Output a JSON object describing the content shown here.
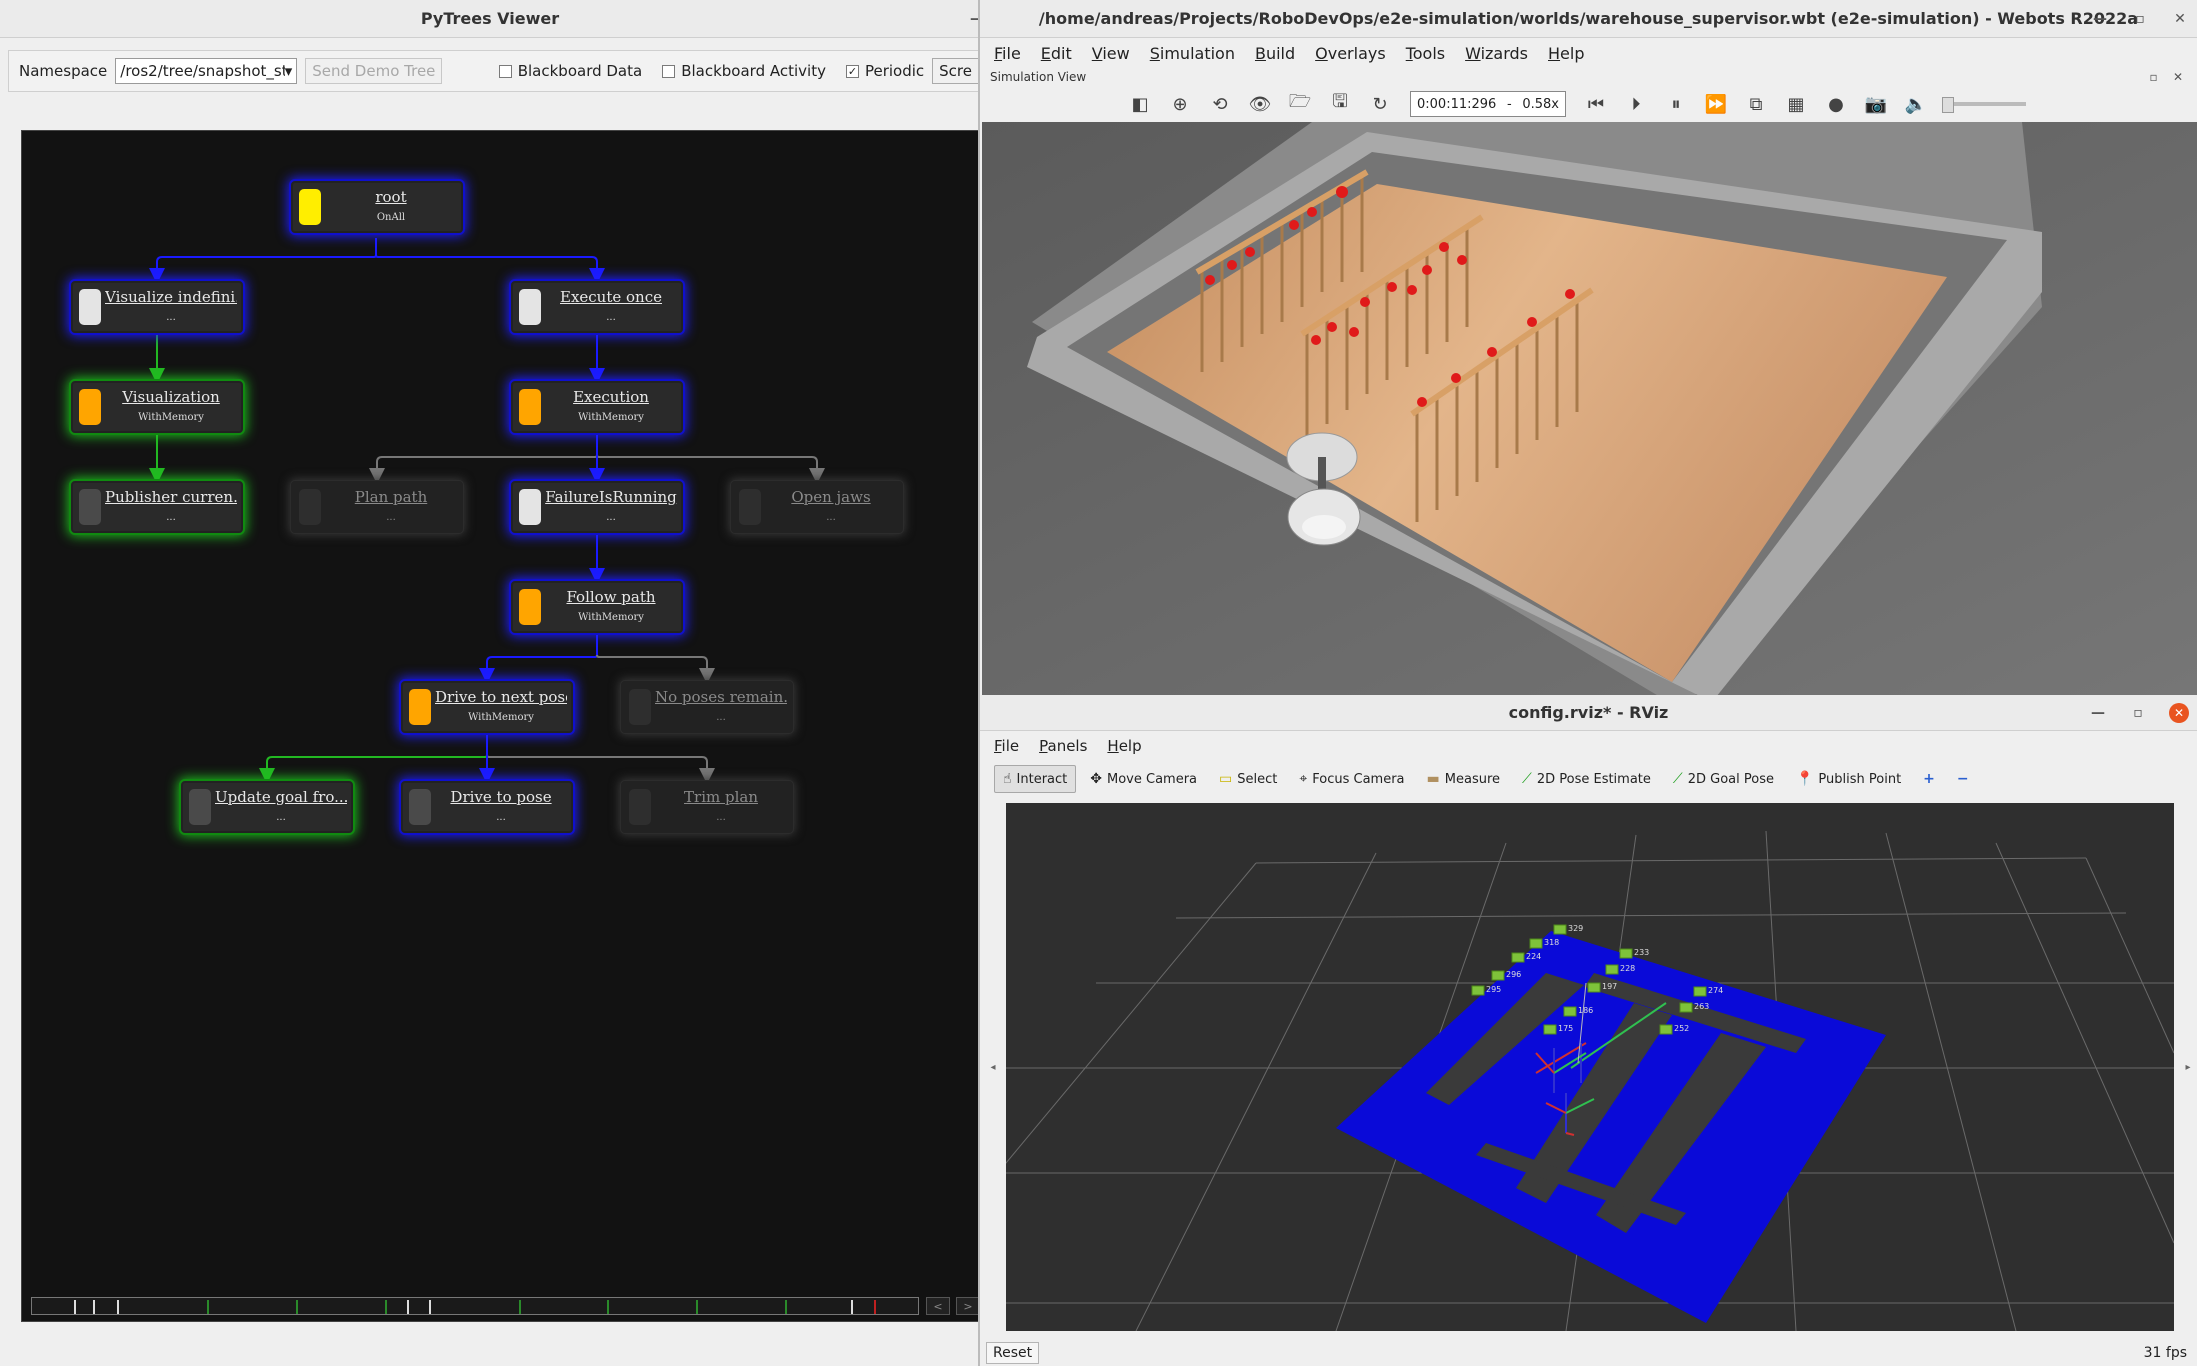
{
  "pytrees": {
    "title": "PyTrees Viewer",
    "namespace_label": "Namespace",
    "namespace_value": "/ros2/tree/snapshot_st",
    "send_demo_label": "Send Demo Tree",
    "blackboard_data_label": "Blackboard Data",
    "blackboard_activity_label": "Blackboard Activity",
    "periodic_label": "Periodic",
    "screenshot_label": "Scre",
    "nodes": {
      "root": {
        "name": "root",
        "sub": "OnAll",
        "status_color": "#ffee00"
      },
      "visualize": {
        "name": "Visualize indefini...",
        "sub": "...",
        "status_color": "#e4e4e4"
      },
      "execute_once": {
        "name": "Execute once",
        "sub": "...",
        "status_color": "#e4e4e4"
      },
      "visualization": {
        "name": "Visualization",
        "sub": "WithMemory",
        "status_color": "#ffa500"
      },
      "execution": {
        "name": "Execution",
        "sub": "WithMemory",
        "status_color": "#ffa500"
      },
      "publisher": {
        "name": "Publisher curren...",
        "sub": "...",
        "status_color": "#4a4a4a"
      },
      "plan_path": {
        "name": "Plan path",
        "sub": "...",
        "status_color": "#2e2e2e"
      },
      "failure_running": {
        "name": "FailureIsRunning",
        "sub": "...",
        "status_color": "#e4e4e4"
      },
      "open_jaws": {
        "name": "Open jaws",
        "sub": "...",
        "status_color": "#2e2e2e"
      },
      "follow_path": {
        "name": "Follow path",
        "sub": "WithMemory",
        "status_color": "#ffa500"
      },
      "drive_next": {
        "name": "Drive to next pose",
        "sub": "WithMemory",
        "status_color": "#ffa500"
      },
      "no_poses": {
        "name": "No poses remain...",
        "sub": "...",
        "status_color": "#2e2e2e"
      },
      "update_goal": {
        "name": "Update goal fro...",
        "sub": "...",
        "status_color": "#4a4a4a"
      },
      "drive_pose": {
        "name": "Drive to pose",
        "sub": "...",
        "status_color": "#4a4a4a"
      },
      "trim_plan": {
        "name": "Trim plan",
        "sub": "...",
        "status_color": "#2e2e2e"
      }
    },
    "timeline_prev": "<",
    "timeline_next": ">"
  },
  "webots": {
    "title": "/home/andreas/Projects/RoboDevOps/e2e-simulation/worlds/warehouse_supervisor.wbt (e2e-simulation) - Webots R2022a",
    "menu": [
      "File",
      "Edit",
      "View",
      "Simulation",
      "Build",
      "Overlays",
      "Tools",
      "Wizards",
      "Help"
    ],
    "sim_view_label": "Simulation View",
    "time": "0:00:11:296",
    "dash": "-",
    "speed": "0.58x"
  },
  "rviz": {
    "title": "config.rviz* - RViz",
    "menu": [
      "File",
      "Panels",
      "Help"
    ],
    "tools": [
      "Interact",
      "Move Camera",
      "Select",
      "Focus Camera",
      "Measure",
      "2D Pose Estimate",
      "2D Goal Pose",
      "Publish Point"
    ],
    "reset_label": "Reset",
    "fps": "31 fps",
    "markers": [
      "329",
      "318",
      "224",
      "296",
      "295",
      "233",
      "228",
      "197",
      "274",
      "263",
      "186",
      "252",
      "175"
    ]
  }
}
